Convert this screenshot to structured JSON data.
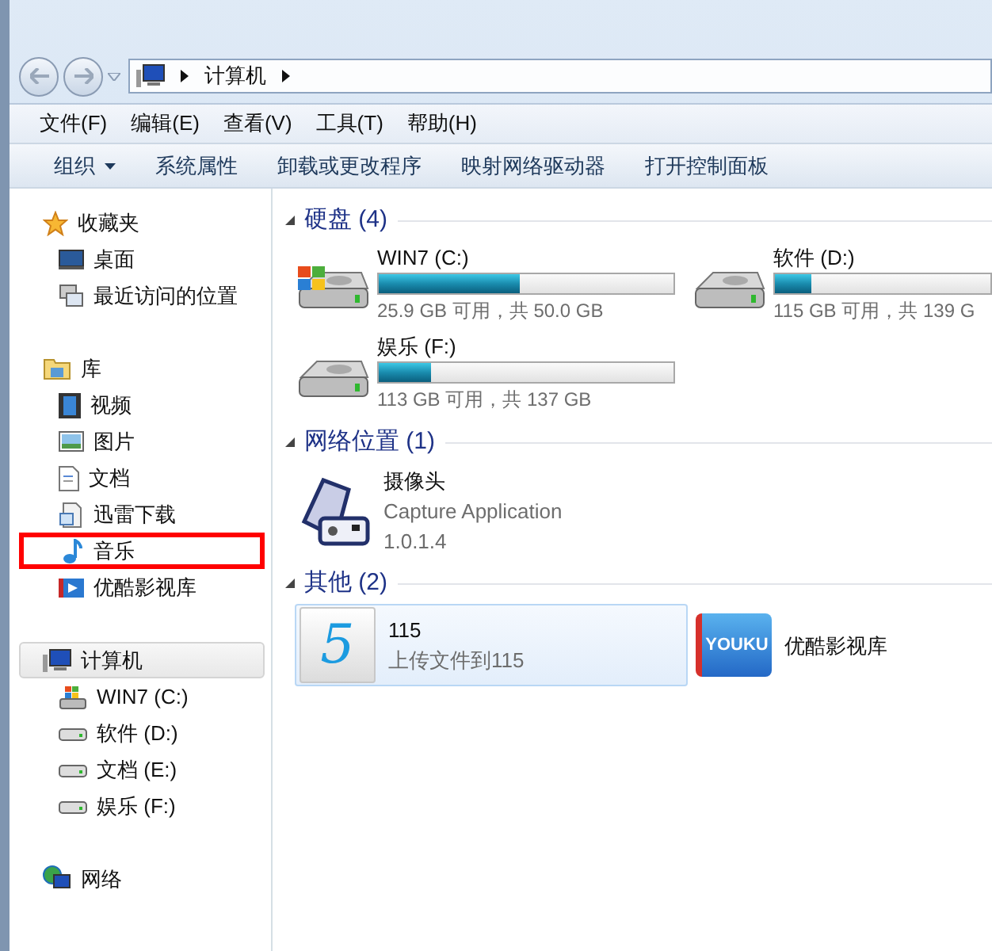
{
  "address": {
    "segments": [
      "计算机"
    ]
  },
  "menu": [
    "文件(F)",
    "编辑(E)",
    "查看(V)",
    "工具(T)",
    "帮助(H)"
  ],
  "toolbar": [
    {
      "label": "组织",
      "has_menu": true
    },
    {
      "label": "系统属性",
      "has_menu": false
    },
    {
      "label": "卸载或更改程序",
      "has_menu": false
    },
    {
      "label": "映射网络驱动器",
      "has_menu": false
    },
    {
      "label": "打开控制面板",
      "has_menu": false
    }
  ],
  "sidebar": [
    {
      "label": "收藏夹",
      "kind": "favorites",
      "selected": false,
      "children": [
        {
          "label": "桌面",
          "kind": "desktop",
          "selected": false,
          "highlighted": false
        },
        {
          "label": "最近访问的位置",
          "kind": "recent",
          "selected": false,
          "highlighted": false
        }
      ]
    },
    {
      "label": "库",
      "kind": "library",
      "selected": false,
      "children": [
        {
          "label": "视频",
          "kind": "video",
          "selected": false,
          "highlighted": false
        },
        {
          "label": "图片",
          "kind": "pictures",
          "selected": false,
          "highlighted": false
        },
        {
          "label": "文档",
          "kind": "documents",
          "selected": false,
          "highlighted": false
        },
        {
          "label": "迅雷下载",
          "kind": "downloads",
          "selected": false,
          "highlighted": false
        },
        {
          "label": "音乐",
          "kind": "music",
          "selected": false,
          "highlighted": true
        },
        {
          "label": "优酷影视库",
          "kind": "videolib",
          "selected": false,
          "highlighted": false
        }
      ]
    },
    {
      "label": "计算机",
      "kind": "computer",
      "selected": true,
      "children": [
        {
          "label": "WIN7 (C:)",
          "kind": "sysdrive",
          "selected": false,
          "highlighted": false
        },
        {
          "label": "软件 (D:)",
          "kind": "drive",
          "selected": false,
          "highlighted": false
        },
        {
          "label": "文档 (E:)",
          "kind": "drive",
          "selected": false,
          "highlighted": false
        },
        {
          "label": "娱乐 (F:)",
          "kind": "drive",
          "selected": false,
          "highlighted": false
        }
      ]
    },
    {
      "label": "网络",
      "kind": "network",
      "selected": false
    }
  ],
  "sections": [
    {
      "title": "硬盘 (4)",
      "expanded": true,
      "items": [
        {
          "kind": "drive",
          "system": true,
          "name": "WIN7 (C:)",
          "level": 0.476,
          "detail": "25.9 GB 可用，共 50.0 GB"
        },
        {
          "kind": "drive",
          "system": false,
          "name": "软件 (D:)",
          "level": 0.17,
          "detail": "115 GB 可用，共 139 G"
        },
        {
          "kind": "drive",
          "system": false,
          "name": "娱乐 (F:)",
          "level": 0.175,
          "detail": "113 GB 可用，共 137 GB"
        }
      ]
    },
    {
      "title": "网络位置 (1)",
      "expanded": true,
      "items": [
        {
          "kind": "device",
          "name": "摄像头",
          "lines": [
            "Capture Application",
            "1.0.1.4"
          ]
        }
      ]
    },
    {
      "title": "其他 (2)",
      "expanded": true,
      "items": [
        {
          "kind": "app",
          "selected": true,
          "icon_text": "5",
          "name": "115",
          "lines": [
            "上传文件到115"
          ]
        },
        {
          "kind": "folder",
          "selected": false,
          "icon_text": "YOUKU",
          "name": "优酷影视库"
        }
      ]
    }
  ]
}
